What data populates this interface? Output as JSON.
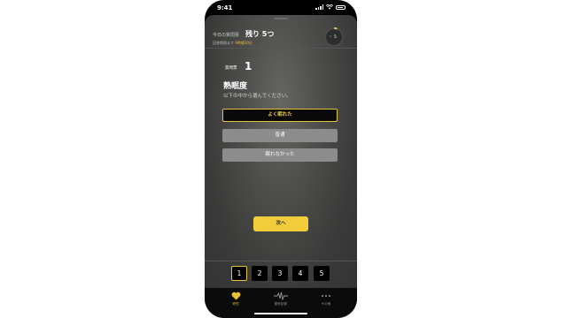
{
  "status": {
    "time": "9:41"
  },
  "header": {
    "remain_label": "今日の質問票",
    "remain_value": "残り 5つ",
    "deadline_prefix": "回答期限まで",
    "deadline_value": "9時間30分",
    "timer_value": "5",
    "timer_zero": "0"
  },
  "question": {
    "label": "質問票",
    "number": "1",
    "title": "熟眠度",
    "instruction": "以下の中から選んでください。",
    "options": [
      {
        "label": "よく眠れた",
        "selected": true
      },
      {
        "label": "普通",
        "selected": false
      },
      {
        "label": "眠れなかった",
        "selected": false
      }
    ]
  },
  "next_label": "次へ",
  "question_nav": [
    "1",
    "2",
    "3",
    "4",
    "5"
  ],
  "active_question": 1,
  "tabs": [
    {
      "label": "研究",
      "icon": "heart-icon",
      "active": true
    },
    {
      "label": "動作記録",
      "icon": "waveform-icon",
      "active": false
    },
    {
      "label": "その他",
      "icon": "more-icon",
      "active": false
    }
  ],
  "colors": {
    "accent": "#f1cd3c",
    "selected_text": "#f0cf3f",
    "option_bg": "#8c8c8c"
  }
}
